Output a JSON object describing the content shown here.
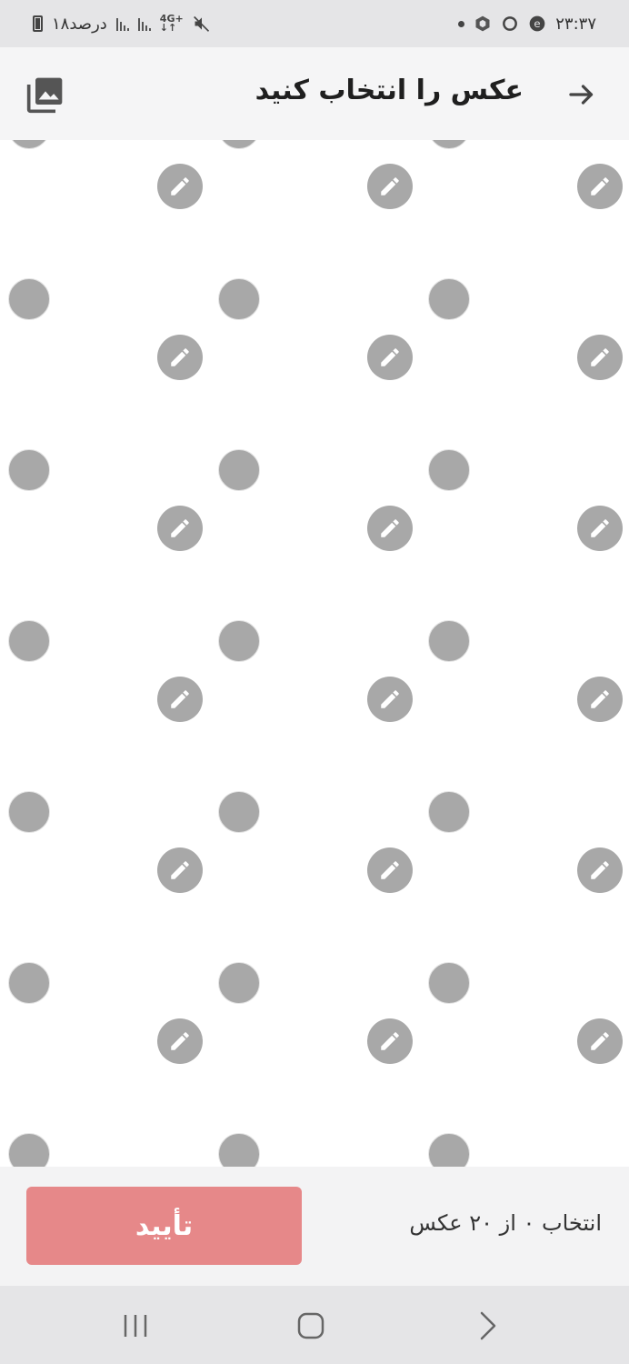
{
  "status_bar": {
    "time": "۲۳:۳۷",
    "battery_text": "۱۸درصد",
    "network_type": "4G+",
    "icons_right": [
      "app-icon-e",
      "sync-icon",
      "hexagon-app-icon",
      "notification-dot"
    ],
    "icons_left": [
      "battery-icon",
      "signal-icon-1",
      "signal-icon-2",
      "network-4g-icon",
      "mute-icon"
    ]
  },
  "app_bar": {
    "title": "عکس را انتخاب کنید",
    "back_icon": "arrow-right-icon",
    "gallery_icon": "photo-library-icon"
  },
  "grid": {
    "columns": 3,
    "rows": 7,
    "tile_icons": [
      "select-circle",
      "edit-pencil-icon"
    ],
    "colors": {
      "placeholder": "#a8a8a8",
      "background": "#ffffff"
    }
  },
  "bottom_bar": {
    "confirm_label": "تأیید",
    "selection_count_text": "انتخاب ۰ از ۲۰ عکس",
    "confirm_color": "#e68889"
  },
  "nav_bar": {
    "icons": [
      "recent-apps-icon",
      "home-icon",
      "back-chevron-icon"
    ]
  }
}
